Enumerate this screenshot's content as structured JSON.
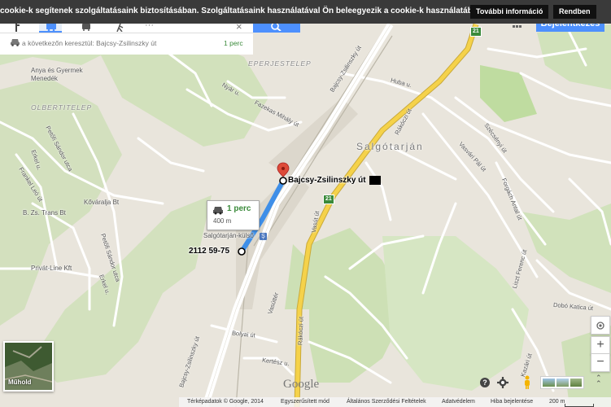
{
  "cookie_bar": {
    "text": "cookie-k segítenek szolgáltatásaink biztosításában. Szolgáltatásaink használatával Ön beleegyezik a cookie-k használatába.",
    "more_info": "További információ",
    "ok": "Rendben"
  },
  "signin": {
    "label": "Bejelentkezés"
  },
  "directions": {
    "via": "a következőn keresztül: Bajcsy-Zsilinszky út",
    "duration": "1 perc"
  },
  "map": {
    "places": {
      "anya": "Anya és Gyermek",
      "menedek": "Menedék",
      "olbertitelep": "OLBERTITELEP",
      "eperjestelep": "EPERJESTELEP",
      "salgotarjan": "Salgótarján",
      "kovaralja": "Kőváralja Bt",
      "bzs": "B. Zs. Trans Bt",
      "privatline": "Privát-Line Kft",
      "station": "Salgótarján-külső"
    },
    "streets": {
      "bajcsy_top": "Bajcsy-Zsilinszky út",
      "bajcsy_bottom": "Bajcsy-Zsilinszky út",
      "nyar": "Nyár u.",
      "fazekas": "Fazekas Mihály út",
      "hunyadi": "Huba u.",
      "rakoczi_top": "Rákóczi út",
      "rakoczi_bottom": "Rákóczi út",
      "vasut": "Vasút út",
      "vasutter": "Vasúttér",
      "petofi1": "Petőfi Sándor utca",
      "petofi2": "Petőfi Sándor utca",
      "erkel1": "Erkel u.",
      "erkel2": "Erkel u.",
      "frankel": "Frankel Leó út",
      "forgach": "Forgách Antal út",
      "vasvari": "Vasvári Pál út",
      "szechenyi": "Szécsényi út",
      "bolyai": "Bolyai út",
      "kertesz": "Kertész u.",
      "kazar": "Kazári út",
      "liszt": "Liszt Ferenc út",
      "dobo": "Dobó Katica út"
    },
    "road_numbers": [
      "21",
      "21"
    ],
    "destination": "Bajcsy-Zsilinszky út",
    "origin": "2112 59-75",
    "route_box": {
      "duration": "1 perc",
      "distance": "400 m"
    },
    "google": "Google",
    "satellite_label": "Műhold"
  },
  "footer": {
    "mapdata": "Térképadatok © Google, 2014",
    "tool": "Egyszerűsített mód",
    "terms": "Általános Szerződési Feltételek",
    "privacy": "Adatvédelem",
    "report": "Hiba bejelentése",
    "scale": "200 m"
  },
  "colors": {
    "route": "#3f8fe8",
    "highway": "#f5d24a",
    "accent": "#4d90fe"
  }
}
